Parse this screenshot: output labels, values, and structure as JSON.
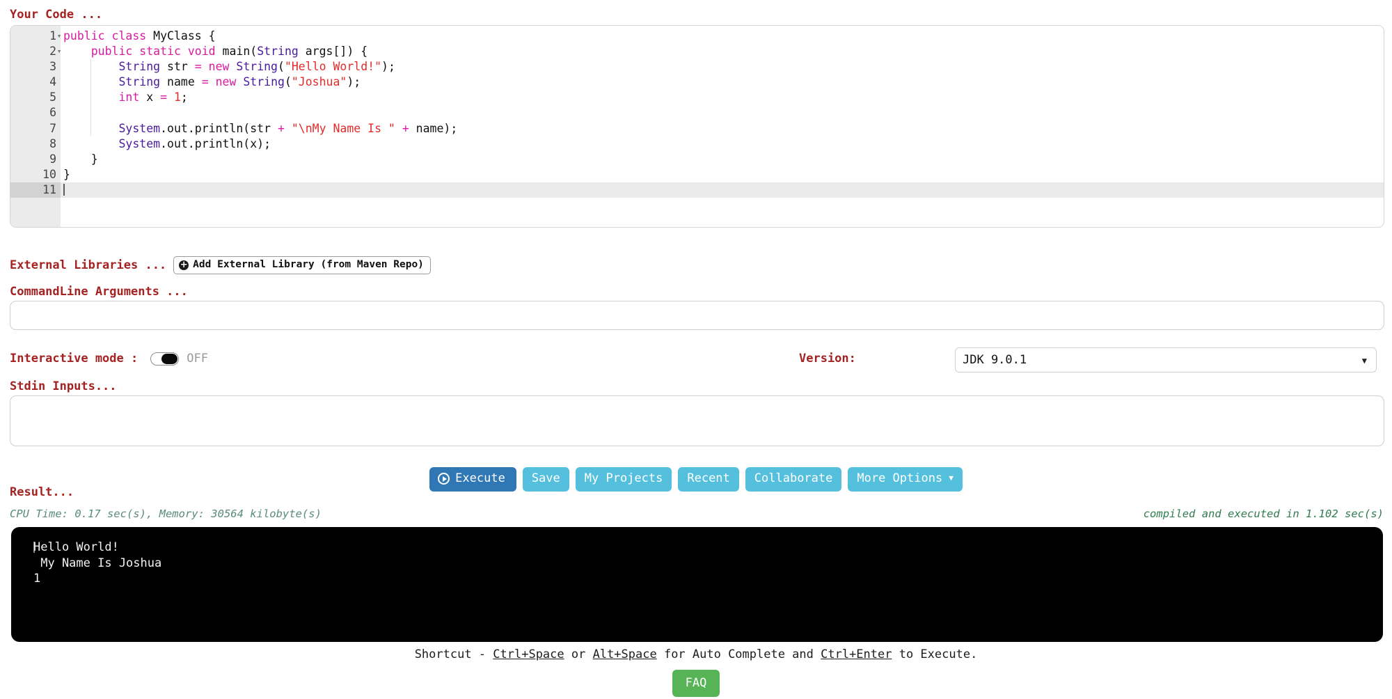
{
  "editor": {
    "heading": "Your Code ...",
    "active_line": 11,
    "total_lines": 11,
    "lines": [
      {
        "n": "1",
        "fold": "▾",
        "tokens": [
          {
            "t": "public",
            "c": "kw"
          },
          {
            "t": " ",
            "c": "pln"
          },
          {
            "t": "class",
            "c": "kw"
          },
          {
            "t": " MyClass {",
            "c": "pln"
          }
        ]
      },
      {
        "n": "2",
        "fold": "▾",
        "tokens": [
          {
            "t": "    ",
            "c": "pln"
          },
          {
            "t": "public",
            "c": "kw"
          },
          {
            "t": " ",
            "c": "pln"
          },
          {
            "t": "static",
            "c": "kw"
          },
          {
            "t": " ",
            "c": "pln"
          },
          {
            "t": "void",
            "c": "kw"
          },
          {
            "t": " main(",
            "c": "pln"
          },
          {
            "t": "String",
            "c": "typ"
          },
          {
            "t": " args[]) {",
            "c": "pln"
          }
        ]
      },
      {
        "n": "3",
        "fold": "",
        "tokens": [
          {
            "t": "        ",
            "c": "pln"
          },
          {
            "t": "String",
            "c": "typ"
          },
          {
            "t": " str ",
            "c": "pln"
          },
          {
            "t": "=",
            "c": "op"
          },
          {
            "t": " ",
            "c": "pln"
          },
          {
            "t": "new",
            "c": "op"
          },
          {
            "t": " ",
            "c": "pln"
          },
          {
            "t": "String",
            "c": "typ"
          },
          {
            "t": "(",
            "c": "pln"
          },
          {
            "t": "\"Hello World!\"",
            "c": "str"
          },
          {
            "t": ");",
            "c": "pln"
          }
        ]
      },
      {
        "n": "4",
        "fold": "",
        "tokens": [
          {
            "t": "        ",
            "c": "pln"
          },
          {
            "t": "String",
            "c": "typ"
          },
          {
            "t": " name ",
            "c": "pln"
          },
          {
            "t": "=",
            "c": "op"
          },
          {
            "t": " ",
            "c": "pln"
          },
          {
            "t": "new",
            "c": "op"
          },
          {
            "t": " ",
            "c": "pln"
          },
          {
            "t": "String",
            "c": "typ"
          },
          {
            "t": "(",
            "c": "pln"
          },
          {
            "t": "\"Joshua\"",
            "c": "str"
          },
          {
            "t": ");",
            "c": "pln"
          }
        ]
      },
      {
        "n": "5",
        "fold": "",
        "tokens": [
          {
            "t": "        ",
            "c": "pln"
          },
          {
            "t": "int",
            "c": "kw"
          },
          {
            "t": " x ",
            "c": "pln"
          },
          {
            "t": "=",
            "c": "op"
          },
          {
            "t": " ",
            "c": "pln"
          },
          {
            "t": "1",
            "c": "num"
          },
          {
            "t": ";",
            "c": "pln"
          }
        ]
      },
      {
        "n": "6",
        "fold": "",
        "tokens": [
          {
            "t": "",
            "c": "pln"
          }
        ]
      },
      {
        "n": "7",
        "fold": "",
        "tokens": [
          {
            "t": "        ",
            "c": "pln"
          },
          {
            "t": "System",
            "c": "typ"
          },
          {
            "t": ".out.println(str ",
            "c": "pln"
          },
          {
            "t": "+",
            "c": "op"
          },
          {
            "t": " ",
            "c": "pln"
          },
          {
            "t": "\"\\nMy Name Is \"",
            "c": "str"
          },
          {
            "t": " ",
            "c": "pln"
          },
          {
            "t": "+",
            "c": "op"
          },
          {
            "t": " name);",
            "c": "pln"
          }
        ]
      },
      {
        "n": "8",
        "fold": "",
        "tokens": [
          {
            "t": "        ",
            "c": "pln"
          },
          {
            "t": "System",
            "c": "typ"
          },
          {
            "t": ".out.println(x);",
            "c": "pln"
          }
        ]
      },
      {
        "n": "9",
        "fold": "",
        "tokens": [
          {
            "t": "    }",
            "c": "pln"
          }
        ]
      },
      {
        "n": "10",
        "fold": "",
        "tokens": [
          {
            "t": "}",
            "c": "pln"
          }
        ]
      },
      {
        "n": "11",
        "fold": "",
        "tokens": [
          {
            "t": "",
            "c": "pln"
          }
        ]
      }
    ]
  },
  "external_libraries": {
    "label": "External Libraries ...",
    "add_button": "Add External Library (from Maven Repo)",
    "add_icon": "plus-circle-icon"
  },
  "commandline": {
    "label": "CommandLine Arguments ...",
    "value": "",
    "placeholder": ""
  },
  "interactive": {
    "label": "Interactive mode :",
    "state": "OFF",
    "on": false
  },
  "version": {
    "label": "Version:",
    "selected": "JDK 9.0.1",
    "caret_icon": "chevron-down-icon"
  },
  "stdin": {
    "label": "Stdin Inputs...",
    "value": "",
    "placeholder": ""
  },
  "actions": {
    "execute": "Execute",
    "execute_icon": "play-circle-icon",
    "save": "Save",
    "my_projects": "My Projects",
    "recent": "Recent",
    "collaborate": "Collaborate",
    "more_options": "More Options",
    "more_options_icon": "caret-down-icon"
  },
  "result": {
    "label": "Result...",
    "stats_left": "CPU Time: 0.17 sec(s), Memory: 30564 kilobyte(s)",
    "stats_right": "compiled and executed in 1.102 sec(s)",
    "console_lines": [
      "Hello World!",
      " My Name Is Joshua",
      "1"
    ]
  },
  "footer": {
    "shortcut_prefix": "Shortcut - ",
    "key1": "Ctrl+Space",
    "mid1": " or ",
    "key2": "Alt+Space",
    "mid2": " for Auto Complete and ",
    "key3": "Ctrl+Enter",
    "suffix": " to Execute.",
    "faq": "FAQ"
  },
  "colors": {
    "label_red": "#a52222",
    "execute_blue": "#2f77b5",
    "button_cyan": "#55c0dd",
    "faq_green": "#56b356",
    "console_bg": "#000000",
    "keyword_magenta": "#d81ba0",
    "type_purple": "#4a1a9e",
    "string_red": "#e42b2b",
    "stat_green": "#2f7d4f"
  }
}
